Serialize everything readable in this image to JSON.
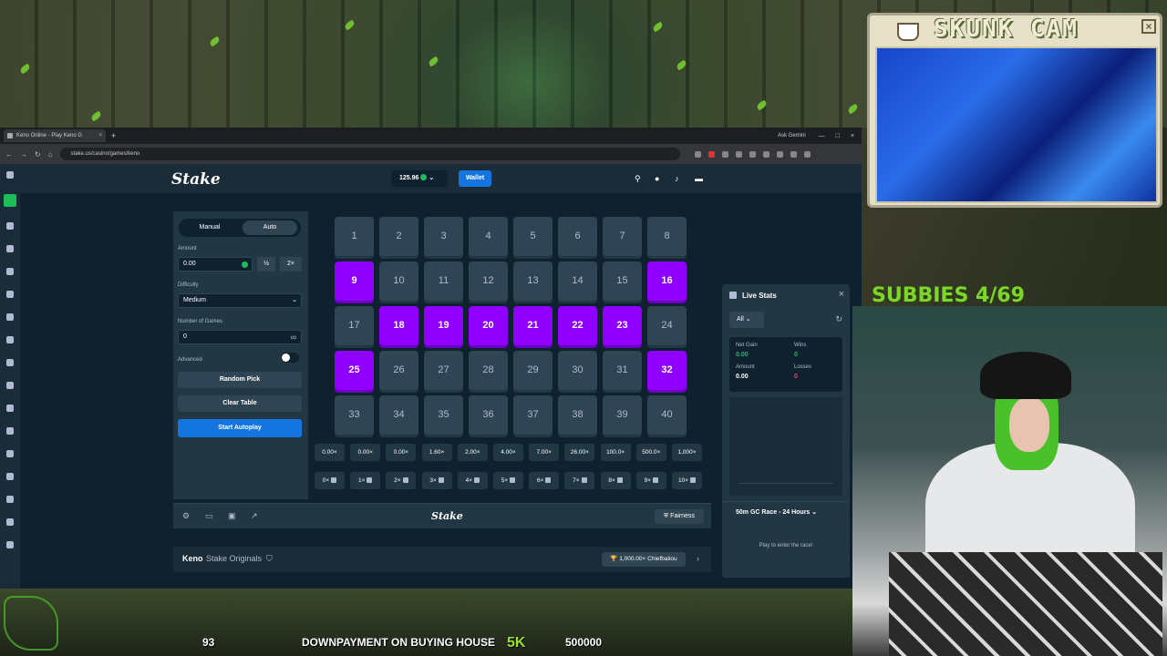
{
  "browser": {
    "tab_title": "Keno Online - Play Keno G",
    "tab_close": "×",
    "new_tab": "+",
    "url": "stake.us/casino/games/keno",
    "ask_gemini": "Ask Gemini"
  },
  "header": {
    "logo": "Stake",
    "balance": "125.96",
    "wallet_label": "Wallet"
  },
  "controls": {
    "mode_manual": "Manual",
    "mode_auto": "Auto",
    "amount_label": "Amount",
    "amount_value": "0.00",
    "half_label": "½",
    "double_label": "2×",
    "difficulty_label": "Difficulty",
    "difficulty_value": "Medium",
    "games_label": "Number of Games",
    "games_value": "0",
    "infinity": "∞",
    "advanced_label": "Advanced",
    "random_pick": "Random Pick",
    "clear_table": "Clear Table",
    "start_autoplay": "Start Autoplay"
  },
  "board": {
    "cells": [
      "1",
      "2",
      "3",
      "4",
      "5",
      "6",
      "7",
      "8",
      "9",
      "10",
      "11",
      "12",
      "13",
      "14",
      "15",
      "16",
      "17",
      "18",
      "19",
      "20",
      "21",
      "22",
      "23",
      "24",
      "25",
      "26",
      "27",
      "28",
      "29",
      "30",
      "31",
      "32",
      "33",
      "34",
      "35",
      "36",
      "37",
      "38",
      "39",
      "40"
    ],
    "selected": [
      9,
      16,
      18,
      19,
      20,
      21,
      22,
      23,
      25,
      32
    ],
    "multipliers": [
      "0.00×",
      "0.00×",
      "0.00×",
      "1.60×",
      "2.00×",
      "4.00×",
      "7.00×",
      "26.00×",
      "100.0×",
      "500.0×",
      "1,000×"
    ],
    "hits": [
      "0×",
      "1×",
      "2×",
      "3×",
      "4×",
      "5×",
      "6×",
      "7×",
      "8×",
      "9×",
      "10×"
    ]
  },
  "footer": {
    "logo": "Stake",
    "fairness": "Fairness",
    "game_name": "Keno",
    "originals": "Stake Originals",
    "big_win": "1,000.00× Chiefbaliou",
    "next_arrow": "›"
  },
  "live_stats": {
    "title": "Live Stats",
    "filter": "All",
    "net_gain_label": "Net Gain",
    "net_gain_value": "0.00",
    "wins_label": "Wins",
    "wins_value": "0",
    "amount_label": "Amount",
    "amount_value": "0.00",
    "losses_label": "Losses",
    "losses_value": "0",
    "race": "50m GC Race - 24 Hours",
    "race_note": "Play to enter the race!"
  },
  "overlay": {
    "cam_title": "SKUNK CAM",
    "subs": "SUBBIES 4/69",
    "bottom_93": "93",
    "goal_text": "DOWNPAYMENT ON BUYING HOUSE",
    "goal_5k": "5K",
    "goal_amount": "500000"
  },
  "colors": {
    "selected_tile": "#9000ff",
    "accent_blue": "#1475e1",
    "stake_bg": "#0f212e",
    "overlay_green": "#7dd62a"
  }
}
